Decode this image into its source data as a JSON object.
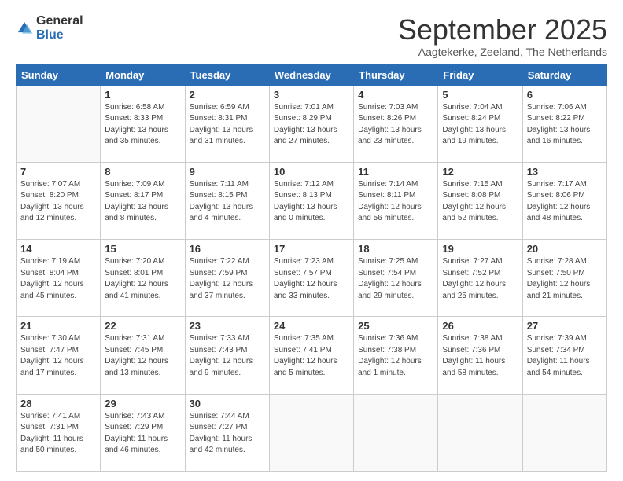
{
  "logo": {
    "general": "General",
    "blue": "Blue"
  },
  "header": {
    "month": "September 2025",
    "location": "Aagtekerke, Zeeland, The Netherlands"
  },
  "weekdays": [
    "Sunday",
    "Monday",
    "Tuesday",
    "Wednesday",
    "Thursday",
    "Friday",
    "Saturday"
  ],
  "weeks": [
    [
      {
        "day": "",
        "info": ""
      },
      {
        "day": "1",
        "info": "Sunrise: 6:58 AM\nSunset: 8:33 PM\nDaylight: 13 hours\nand 35 minutes."
      },
      {
        "day": "2",
        "info": "Sunrise: 6:59 AM\nSunset: 8:31 PM\nDaylight: 13 hours\nand 31 minutes."
      },
      {
        "day": "3",
        "info": "Sunrise: 7:01 AM\nSunset: 8:29 PM\nDaylight: 13 hours\nand 27 minutes."
      },
      {
        "day": "4",
        "info": "Sunrise: 7:03 AM\nSunset: 8:26 PM\nDaylight: 13 hours\nand 23 minutes."
      },
      {
        "day": "5",
        "info": "Sunrise: 7:04 AM\nSunset: 8:24 PM\nDaylight: 13 hours\nand 19 minutes."
      },
      {
        "day": "6",
        "info": "Sunrise: 7:06 AM\nSunset: 8:22 PM\nDaylight: 13 hours\nand 16 minutes."
      }
    ],
    [
      {
        "day": "7",
        "info": "Sunrise: 7:07 AM\nSunset: 8:20 PM\nDaylight: 13 hours\nand 12 minutes."
      },
      {
        "day": "8",
        "info": "Sunrise: 7:09 AM\nSunset: 8:17 PM\nDaylight: 13 hours\nand 8 minutes."
      },
      {
        "day": "9",
        "info": "Sunrise: 7:11 AM\nSunset: 8:15 PM\nDaylight: 13 hours\nand 4 minutes."
      },
      {
        "day": "10",
        "info": "Sunrise: 7:12 AM\nSunset: 8:13 PM\nDaylight: 13 hours\nand 0 minutes."
      },
      {
        "day": "11",
        "info": "Sunrise: 7:14 AM\nSunset: 8:11 PM\nDaylight: 12 hours\nand 56 minutes."
      },
      {
        "day": "12",
        "info": "Sunrise: 7:15 AM\nSunset: 8:08 PM\nDaylight: 12 hours\nand 52 minutes."
      },
      {
        "day": "13",
        "info": "Sunrise: 7:17 AM\nSunset: 8:06 PM\nDaylight: 12 hours\nand 48 minutes."
      }
    ],
    [
      {
        "day": "14",
        "info": "Sunrise: 7:19 AM\nSunset: 8:04 PM\nDaylight: 12 hours\nand 45 minutes."
      },
      {
        "day": "15",
        "info": "Sunrise: 7:20 AM\nSunset: 8:01 PM\nDaylight: 12 hours\nand 41 minutes."
      },
      {
        "day": "16",
        "info": "Sunrise: 7:22 AM\nSunset: 7:59 PM\nDaylight: 12 hours\nand 37 minutes."
      },
      {
        "day": "17",
        "info": "Sunrise: 7:23 AM\nSunset: 7:57 PM\nDaylight: 12 hours\nand 33 minutes."
      },
      {
        "day": "18",
        "info": "Sunrise: 7:25 AM\nSunset: 7:54 PM\nDaylight: 12 hours\nand 29 minutes."
      },
      {
        "day": "19",
        "info": "Sunrise: 7:27 AM\nSunset: 7:52 PM\nDaylight: 12 hours\nand 25 minutes."
      },
      {
        "day": "20",
        "info": "Sunrise: 7:28 AM\nSunset: 7:50 PM\nDaylight: 12 hours\nand 21 minutes."
      }
    ],
    [
      {
        "day": "21",
        "info": "Sunrise: 7:30 AM\nSunset: 7:47 PM\nDaylight: 12 hours\nand 17 minutes."
      },
      {
        "day": "22",
        "info": "Sunrise: 7:31 AM\nSunset: 7:45 PM\nDaylight: 12 hours\nand 13 minutes."
      },
      {
        "day": "23",
        "info": "Sunrise: 7:33 AM\nSunset: 7:43 PM\nDaylight: 12 hours\nand 9 minutes."
      },
      {
        "day": "24",
        "info": "Sunrise: 7:35 AM\nSunset: 7:41 PM\nDaylight: 12 hours\nand 5 minutes."
      },
      {
        "day": "25",
        "info": "Sunrise: 7:36 AM\nSunset: 7:38 PM\nDaylight: 12 hours\nand 1 minute."
      },
      {
        "day": "26",
        "info": "Sunrise: 7:38 AM\nSunset: 7:36 PM\nDaylight: 11 hours\nand 58 minutes."
      },
      {
        "day": "27",
        "info": "Sunrise: 7:39 AM\nSunset: 7:34 PM\nDaylight: 11 hours\nand 54 minutes."
      }
    ],
    [
      {
        "day": "28",
        "info": "Sunrise: 7:41 AM\nSunset: 7:31 PM\nDaylight: 11 hours\nand 50 minutes."
      },
      {
        "day": "29",
        "info": "Sunrise: 7:43 AM\nSunset: 7:29 PM\nDaylight: 11 hours\nand 46 minutes."
      },
      {
        "day": "30",
        "info": "Sunrise: 7:44 AM\nSunset: 7:27 PM\nDaylight: 11 hours\nand 42 minutes."
      },
      {
        "day": "",
        "info": ""
      },
      {
        "day": "",
        "info": ""
      },
      {
        "day": "",
        "info": ""
      },
      {
        "day": "",
        "info": ""
      }
    ]
  ]
}
